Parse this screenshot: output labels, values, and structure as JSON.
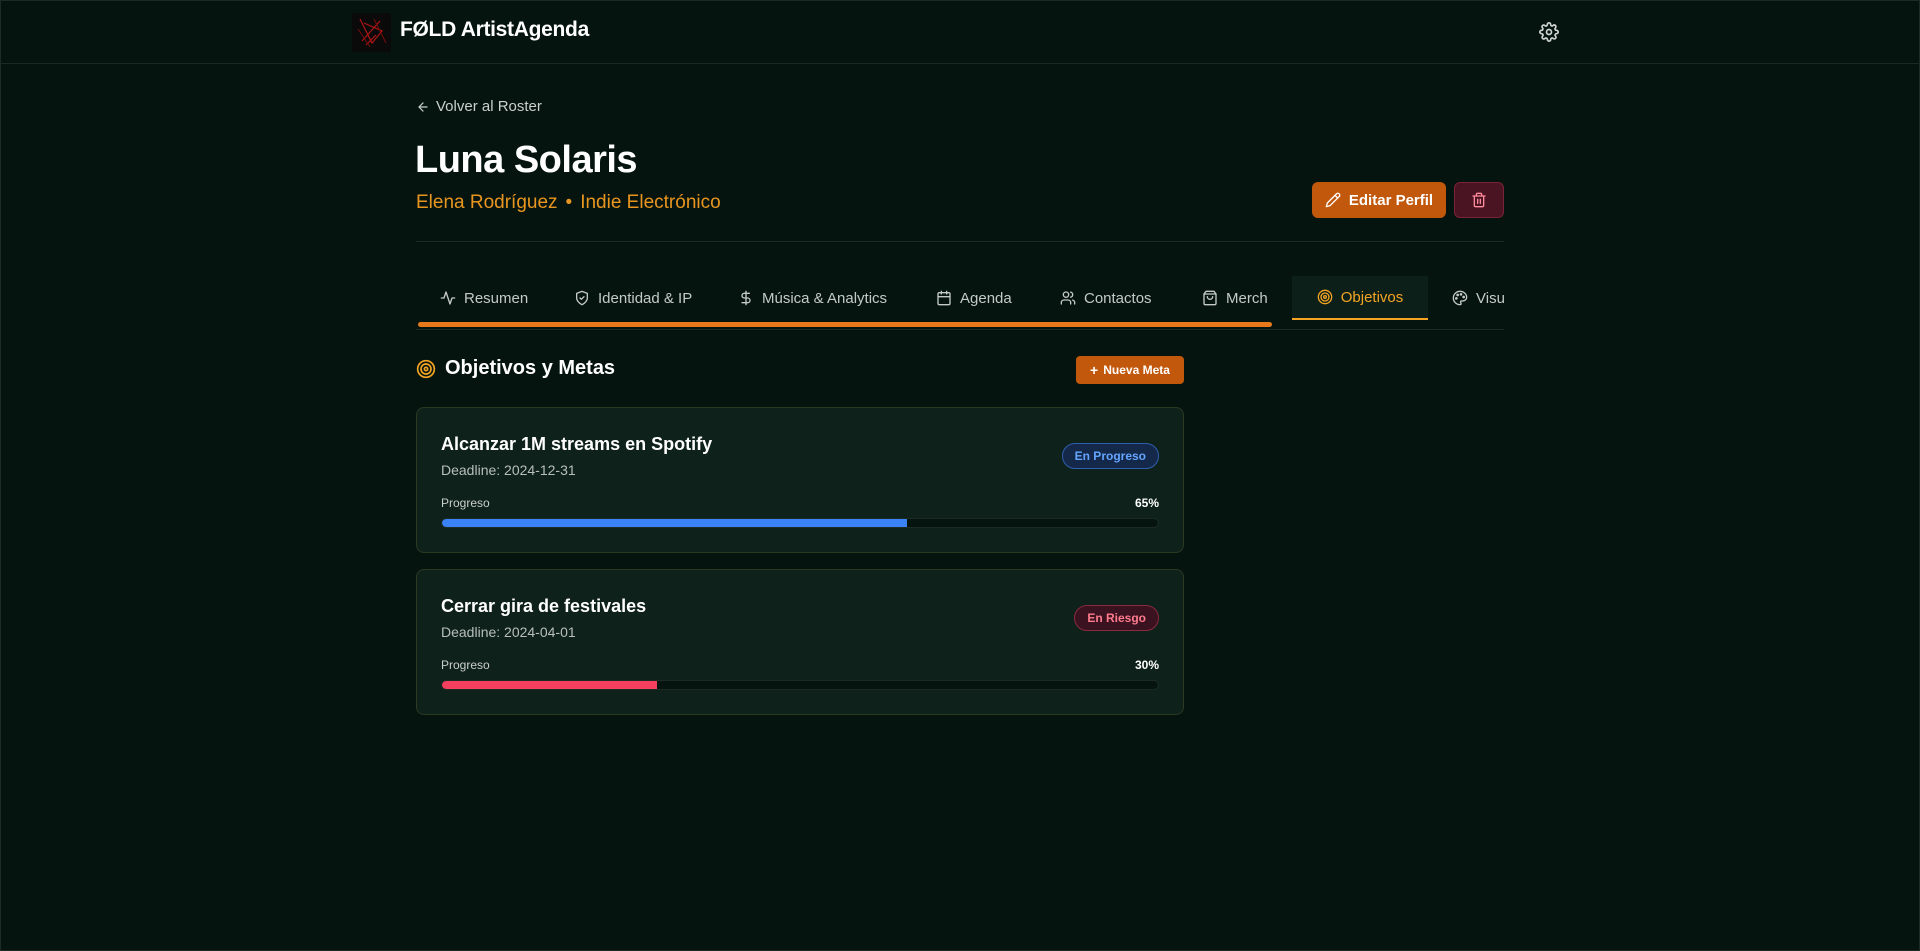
{
  "app": {
    "title": "FØLD ArtistAgenda"
  },
  "nav": {
    "back_label": "Volver al Roster"
  },
  "artist": {
    "name": "Luna Solaris",
    "real_name": "Elena Rodríguez",
    "separator": "•",
    "genre": "Indie Electrónico"
  },
  "actions": {
    "edit_label": "Editar Perfil"
  },
  "tabs": [
    {
      "label": "Resumen",
      "icon": "activity-icon"
    },
    {
      "label": "Identidad & IP",
      "icon": "shield-icon"
    },
    {
      "label": "Música & Analytics",
      "icon": "dollar-icon"
    },
    {
      "label": "Agenda",
      "icon": "calendar-icon"
    },
    {
      "label": "Contactos",
      "icon": "users-icon"
    },
    {
      "label": "Merch",
      "icon": "shopping-bag-icon"
    },
    {
      "label": "Objetivos",
      "icon": "target-icon",
      "active": true
    },
    {
      "label": "Visu",
      "icon": "palette-icon"
    }
  ],
  "goals_section": {
    "title": "Objetivos y Metas",
    "new_label": "Nueva Meta",
    "progress_label": "Progreso",
    "goals": [
      {
        "title": "Alcanzar 1M streams en Spotify",
        "deadline": "Deadline: 2024-12-31",
        "status": "En Progreso",
        "progress": 65,
        "progress_text": "65%",
        "color": "#3b82f6"
      },
      {
        "title": "Cerrar gira de festivales",
        "deadline": "Deadline: 2024-04-01",
        "status": "En Riesgo",
        "progress": 30,
        "progress_text": "30%",
        "color": "#f43f5e"
      }
    ]
  },
  "colors": {
    "background": "#061410",
    "accent": "#c2580c",
    "highlight": "#f5a524"
  }
}
